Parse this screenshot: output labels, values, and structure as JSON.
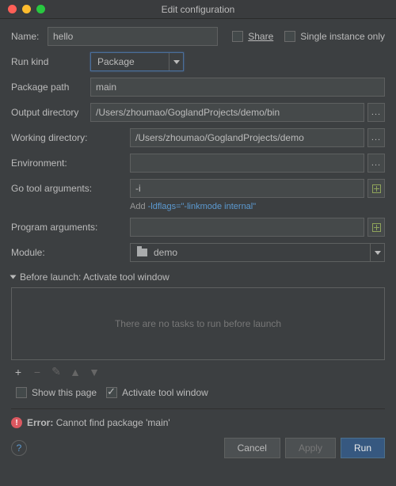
{
  "titlebar": {
    "title": "Edit configuration"
  },
  "fields": {
    "name": {
      "label": "Name:",
      "value": "hello"
    },
    "share": {
      "label": "Share"
    },
    "single_instance": {
      "label": "Single instance only"
    },
    "run_kind": {
      "label": "Run kind",
      "value": "Package"
    },
    "package_path": {
      "label": "Package path",
      "value": "main"
    },
    "output_dir": {
      "label": "Output directory",
      "value": "/Users/zhoumao/GoglandProjects/demo/bin"
    },
    "working_dir": {
      "label": "Working directory:",
      "value": "/Users/zhoumao/GoglandProjects/demo"
    },
    "environment": {
      "label": "Environment:",
      "value": ""
    },
    "go_tool_args": {
      "label": "Go tool arguments:",
      "value": "-i"
    },
    "go_tool_hint_prefix": "Add ",
    "go_tool_hint_link": "-ldflags=\"-linkmode internal\"",
    "program_args": {
      "label": "Program arguments:",
      "value": ""
    },
    "module": {
      "label": "Module:",
      "value": "demo"
    }
  },
  "before_launch": {
    "header": "Before launch: Activate tool window",
    "empty_text": "There are no tasks to run before launch",
    "show_page": "Show this page",
    "activate": "Activate tool window"
  },
  "error": {
    "label": "Error:",
    "msg": "Cannot find package 'main'"
  },
  "buttons": {
    "cancel": "Cancel",
    "apply": "Apply",
    "run": "Run"
  }
}
